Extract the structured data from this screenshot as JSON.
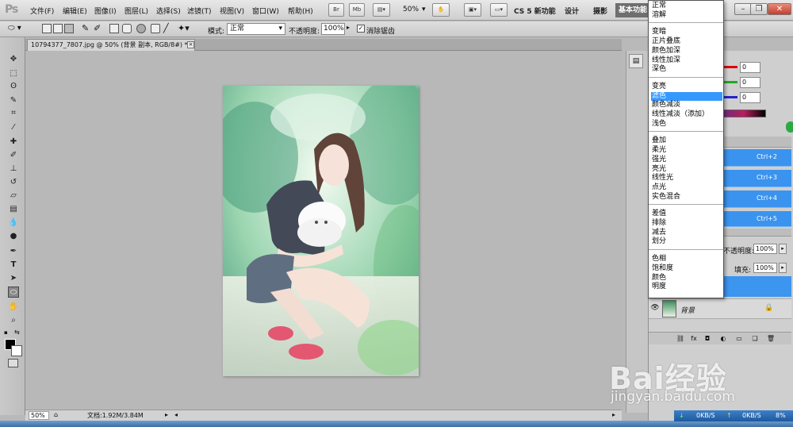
{
  "app": {
    "logo": "Ps"
  },
  "menus": [
    "文件(F)",
    "编辑(E)",
    "图像(I)",
    "图层(L)",
    "选择(S)",
    "滤镜(T)",
    "视图(V)",
    "窗口(W)",
    "帮助(H)"
  ],
  "app_bar": {
    "br": "Br",
    "mb": "Mb",
    "zoom": "50%"
  },
  "workspaces": {
    "cs5": "CS 5 新功能",
    "design": "设计",
    "photo": "摄影",
    "basic": "基本功能"
  },
  "options": {
    "mode_label": "模式:",
    "mode_value": "正常",
    "opacity_label": "不透明度:",
    "opacity_value": "100%",
    "antialias_check": "✓",
    "antialias_label": "消除锯齿"
  },
  "document": {
    "tab_title": "10794377_7807.jpg @ 50% (背景 副本, RGB/8#) *",
    "zoom": "50%",
    "doc_info": "文档:1.92M/3.84M"
  },
  "blend_modes": {
    "groups": [
      [
        "正常",
        "溶解"
      ],
      [
        "变暗",
        "正片叠底",
        "颜色加深",
        "线性加深",
        "深色"
      ],
      [
        "变亮",
        "滤色",
        "颜色减淡",
        "线性减淡（添加）",
        "浅色"
      ],
      [
        "叠加",
        "柔光",
        "强光",
        "亮光",
        "线性光",
        "点光",
        "实色混合"
      ],
      [
        "差值",
        "排除",
        "减去",
        "划分"
      ],
      [
        "色相",
        "饱和度",
        "颜色",
        "明度"
      ]
    ],
    "selected": "滤色"
  },
  "color_panel": {
    "r": "0",
    "g": "0",
    "b": "0"
  },
  "actions": [
    "Ctrl+2",
    "Ctrl+3",
    "Ctrl+4",
    "Ctrl+5"
  ],
  "layers": {
    "opacity_label": "不透明度:",
    "opacity_value": "100%",
    "fill_label": "填充:",
    "fill_value": "100%",
    "bg_name": "背景"
  },
  "network": {
    "down": "0KB/S",
    "up": "0KB/S",
    "pct": "8%"
  },
  "watermark": {
    "logo": "Bai经验",
    "url": "jingyan.baidu.com"
  },
  "colors": {
    "selection": "#3399ff",
    "panel_bg": "#cfcfcf",
    "canvas_bg": "#b8b8b8"
  }
}
